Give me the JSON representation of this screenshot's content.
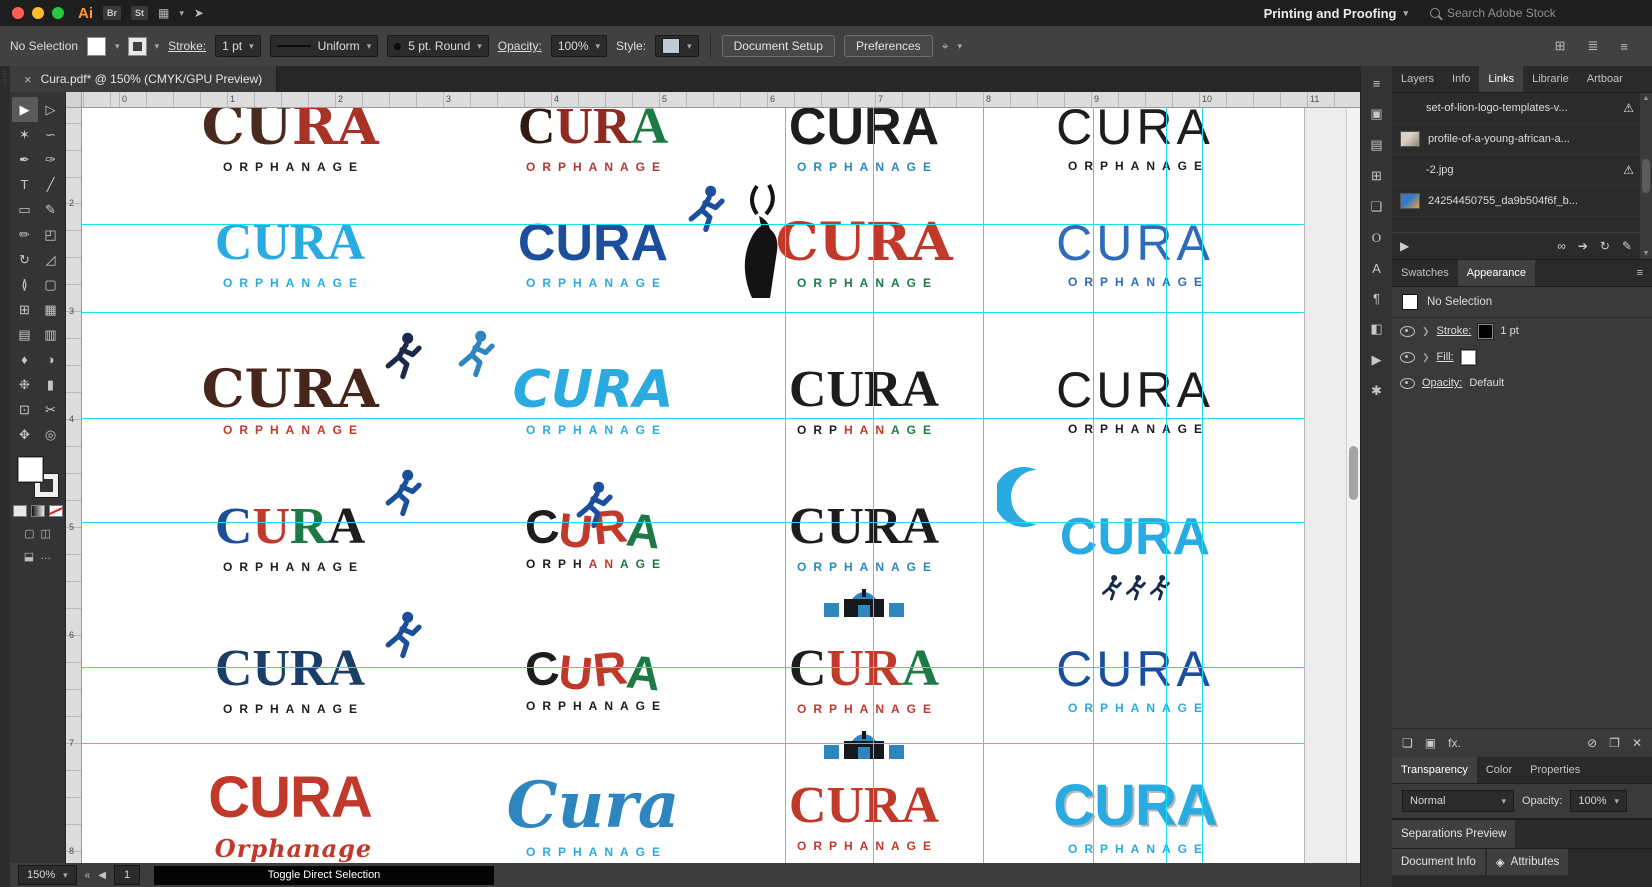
{
  "menubar": {
    "app_badge": "Ai",
    "badge_br": "Br",
    "badge_st": "St",
    "workspace_label": "Printing and Proofing",
    "search_placeholder": "Search Adobe Stock"
  },
  "controlbar": {
    "selection_label": "No Selection",
    "stroke_label": "Stroke:",
    "stroke_value": "1 pt",
    "profile_value": "Uniform",
    "brush_value": "5 pt. Round",
    "opacity_label": "Opacity:",
    "opacity_value": "100%",
    "style_label": "Style:",
    "document_setup_label": "Document Setup",
    "preferences_label": "Preferences"
  },
  "document_tab": {
    "title": "Cura.pdf* @ 150% (CMYK/GPU Preview)",
    "close": "×"
  },
  "rulers": {
    "horizontal": [
      "0",
      "1",
      "2",
      "3",
      "4",
      "5",
      "6",
      "7",
      "8",
      "9",
      "10",
      "11"
    ],
    "vertical": [
      "2",
      "3",
      "4",
      "5",
      "6",
      "7",
      "8"
    ]
  },
  "tools": [
    {
      "name": "selection",
      "glyph": "▶"
    },
    {
      "name": "direct-selection",
      "glyph": "▷"
    },
    {
      "name": "magic-wand",
      "glyph": "✶"
    },
    {
      "name": "lasso",
      "glyph": "∽"
    },
    {
      "name": "pen",
      "glyph": "✒"
    },
    {
      "name": "curvature",
      "glyph": "✑"
    },
    {
      "name": "type",
      "glyph": "T"
    },
    {
      "name": "line-segment",
      "glyph": "╱"
    },
    {
      "name": "rectangle",
      "glyph": "▭"
    },
    {
      "name": "paintbrush",
      "glyph": "✎"
    },
    {
      "name": "pencil",
      "glyph": "✏"
    },
    {
      "name": "shaper",
      "glyph": "◰"
    },
    {
      "name": "rotate",
      "glyph": "↻"
    },
    {
      "name": "scale",
      "glyph": "◿"
    },
    {
      "name": "width",
      "glyph": "≬"
    },
    {
      "name": "free-transform",
      "glyph": "▢"
    },
    {
      "name": "shape-builder",
      "glyph": "⊞"
    },
    {
      "name": "perspective-grid",
      "glyph": "▦"
    },
    {
      "name": "mesh",
      "glyph": "▤"
    },
    {
      "name": "gradient",
      "glyph": "▥"
    },
    {
      "name": "eyedropper",
      "glyph": "♦"
    },
    {
      "name": "blend",
      "glyph": "◑"
    },
    {
      "name": "symbol-sprayer",
      "glyph": "❉"
    },
    {
      "name": "column-graph",
      "glyph": "▮"
    },
    {
      "name": "artboard",
      "glyph": "⊡"
    },
    {
      "name": "slice",
      "glyph": "✂"
    },
    {
      "name": "hand",
      "glyph": "✥"
    },
    {
      "name": "zoom",
      "glyph": "◎"
    }
  ],
  "dock_icons": [
    {
      "name": "panel-menu",
      "glyph": "≡"
    },
    {
      "name": "color-panel",
      "glyph": "▣"
    },
    {
      "name": "libraries-panel",
      "glyph": "▤"
    },
    {
      "name": "transform-panel",
      "glyph": "⊞"
    },
    {
      "name": "symbols-panel",
      "glyph": "❏"
    },
    {
      "name": "opentype-panel",
      "glyph": "O"
    },
    {
      "name": "character-panel",
      "glyph": "A"
    },
    {
      "name": "paragraph-panel",
      "glyph": "¶"
    },
    {
      "name": "gradient-panel",
      "glyph": "◧"
    },
    {
      "name": "actions-panel",
      "glyph": "▶"
    },
    {
      "name": "settings-panel",
      "glyph": "✱"
    }
  ],
  "panels": {
    "primary_tabs": [
      {
        "label": "Layers"
      },
      {
        "label": "Info"
      },
      {
        "label": "Links"
      },
      {
        "label": "Librarie"
      },
      {
        "label": "Artboar"
      }
    ],
    "links": {
      "items": [
        {
          "name": "set-of-lion-logo-templates-v...",
          "warning": true,
          "thumb": null
        },
        {
          "name": "profile-of-a-young-african-a...",
          "warning": false,
          "thumb": "photo"
        },
        {
          "name": "-2.jpg",
          "warning": true,
          "thumb": null
        },
        {
          "name": "24254450755_da9b504f6f_b...",
          "warning": false,
          "thumb": "color"
        }
      ],
      "footer_icons": [
        {
          "name": "relink",
          "glyph": "∞"
        },
        {
          "name": "go-to-link",
          "glyph": "➔"
        },
        {
          "name": "update-link",
          "glyph": "↻"
        },
        {
          "name": "edit-original",
          "glyph": "✎"
        }
      ]
    },
    "secondary_tabs": [
      {
        "label": "Swatches"
      },
      {
        "label": "Appearance"
      }
    ],
    "appearance": {
      "selection_label": "No Selection",
      "stroke_label": "Stroke:",
      "stroke_value": "1 pt",
      "fill_label": "Fill:",
      "opacity_label": "Opacity:",
      "opacity_value": "Default",
      "fx_label": "fx."
    },
    "tertiary_tabs": [
      {
        "label": "Transparency"
      },
      {
        "label": "Color"
      },
      {
        "label": "Properties"
      }
    ],
    "transparency": {
      "blend_mode": "Normal",
      "opacity_label": "Opacity:",
      "opacity_value": "100%"
    },
    "separations_label": "Separations Preview",
    "document_info_label": "Document Info",
    "attributes_label": "Attributes"
  },
  "statusbar": {
    "zoom": "150%",
    "artboard_number": "1",
    "tooltip": "Toggle Direct Selection"
  },
  "canvas": {
    "default_main": "CURA",
    "default_sub": "ORPHANAGE",
    "guide_color": "#19dff2",
    "guides": {
      "vertical": [
        703,
        791,
        901,
        1011,
        1084,
        1120
      ],
      "horizontal": [
        116,
        204,
        310,
        414,
        559,
        635
      ]
    },
    "columns": [
      208,
      511,
      782,
      1053
    ],
    "rows": [
      29,
      145,
      292,
      429,
      571,
      708
    ],
    "logos": [
      {
        "style": "slab",
        "letters": [
          [
            "C",
            "#4a2a1e"
          ],
          [
            "U",
            "#4a2a1e"
          ],
          [
            "R",
            "#a93226"
          ],
          [
            "A",
            "#a93226"
          ]
        ],
        "sub_color": "#1d1d1d"
      },
      {
        "style": "serif",
        "letters": [
          [
            "C",
            "#2f1a10"
          ],
          [
            "U",
            "#8e2a22"
          ],
          [
            "R",
            "#8e2a22"
          ],
          [
            "A",
            "#1e7a44"
          ]
        ],
        "sub_color": "#b03a2e"
      },
      {
        "style": "sans",
        "main_color": "#1d1d1d",
        "sub_color": "#2e86c1",
        "extra": {
          "type": "building",
          "color": "#2e86c1",
          "pos": "top"
        }
      },
      {
        "style": "thin",
        "main_color": "#1d1d1d",
        "sub_color": "#1d1d1d"
      },
      {
        "style": "serif",
        "main_color": "#29abe2",
        "sub_color": "#29abe2"
      },
      {
        "style": "sans",
        "main_color": "#1b4f9c",
        "sub_color": "#29abe2",
        "extra": {
          "type": "runner",
          "color": "#1b4f9c",
          "pos": "right"
        }
      },
      {
        "style": "slab",
        "main_color": "#c0392b",
        "sub_color": "#1e7a44",
        "extra": {
          "type": "kudu",
          "color": "#131313",
          "pos": "left"
        }
      },
      {
        "style": "thin",
        "main_color": "#2e6bb8",
        "sub_color": "#2e6bb8"
      },
      {
        "style": "slab",
        "main_color": "#46251a",
        "sub_color": "#c0392b",
        "extra": {
          "type": "runner",
          "color": "#1a2a4a",
          "pos": "right"
        }
      },
      {
        "style": "rounded",
        "main_color": "#29abe2",
        "sub_color": "#29abe2",
        "extra": {
          "type": "runner",
          "color": "#2e86c1",
          "pos": "left"
        }
      },
      {
        "style": "serif",
        "main_color": "#1d1d1d",
        "sub_segments": [
          [
            "ORP",
            "#1d1d1d"
          ],
          [
            "HAN",
            "#c0392b"
          ],
          [
            "AGE",
            "#1e7a44"
          ]
        ]
      },
      {
        "style": "thin",
        "main_color": "#1d1d1d",
        "sub_color": "#1d1d1d"
      },
      {
        "style": "serif",
        "letters": [
          [
            "C",
            "#1b4f9c"
          ],
          [
            "U",
            "#c0392b"
          ],
          [
            "R",
            "#1e7a44"
          ],
          [
            "A",
            "#1d1d1d"
          ]
        ],
        "sub_color": "#1d1d1d",
        "extra": {
          "type": "runner",
          "color": "#1b4f9c",
          "pos": "right"
        }
      },
      {
        "style": "block",
        "letters": [
          [
            "C",
            "#1d1d1d"
          ],
          [
            "U",
            "#c0392b"
          ],
          [
            "R",
            "#c0392b"
          ],
          [
            "A",
            "#1e7a44"
          ]
        ],
        "sub_segments": [
          [
            "ORPH",
            "#1d1d1d"
          ],
          [
            "AN",
            "#c0392b"
          ],
          [
            "AGE",
            "#1e7a44"
          ]
        ],
        "extra": {
          "type": "runner",
          "color": "#1b4f9c",
          "pos": "mid"
        }
      },
      {
        "style": "serif",
        "main_color": "#1d1d1d",
        "sub_color": "#2e86c1",
        "extra": {
          "type": "building",
          "color": "#2e86c1",
          "pos": "bottom"
        }
      },
      {
        "style": "sans",
        "main_color": "#29abe2",
        "sub": "",
        "extra": {
          "type": "face",
          "color": "#29abe2",
          "pos": "left"
        }
      },
      {
        "style": "serif",
        "main_color": "#1a3e66",
        "sub_color": "#1d1d1d",
        "extra": {
          "type": "runner",
          "color": "#1b4f9c",
          "pos": "right"
        }
      },
      {
        "style": "block",
        "letters": [
          [
            "C",
            "#1d1d1d"
          ],
          [
            "U",
            "#c0392b"
          ],
          [
            "R",
            "#c0392b"
          ],
          [
            "A",
            "#1e7a44"
          ]
        ],
        "sub_color": "#1d1d1d"
      },
      {
        "style": "serif",
        "letters": [
          [
            "C",
            "#1d1d1d"
          ],
          [
            "U",
            "#c0392b"
          ],
          [
            "R",
            "#c0392b"
          ],
          [
            "A",
            "#1e7a44"
          ]
        ],
        "sub_color": "#c0392b",
        "extra": {
          "type": "building",
          "color": "#2e86c1",
          "pos": "bottom"
        }
      },
      {
        "style": "thin",
        "main_color": "#1b4f9c",
        "sub_color": "#29abe2",
        "extra": {
          "type": "runners3",
          "color": "#1a2a4a",
          "pos": "top"
        }
      },
      {
        "style": "heavy",
        "main_color": "#c0392b",
        "sub": "Orphanage",
        "sub_style": "script",
        "sub_color": "#c0392b"
      },
      {
        "style": "script",
        "main": "Cura",
        "main_color": "#2e86c1",
        "sub_color": "#29abe2"
      },
      {
        "style": "serif",
        "main_color": "#c0392b",
        "sub_color": "#c0392b"
      },
      {
        "style": "heavy",
        "main_color": "#29abe2",
        "sub_color": "#29abe2",
        "outline": true
      }
    ]
  }
}
